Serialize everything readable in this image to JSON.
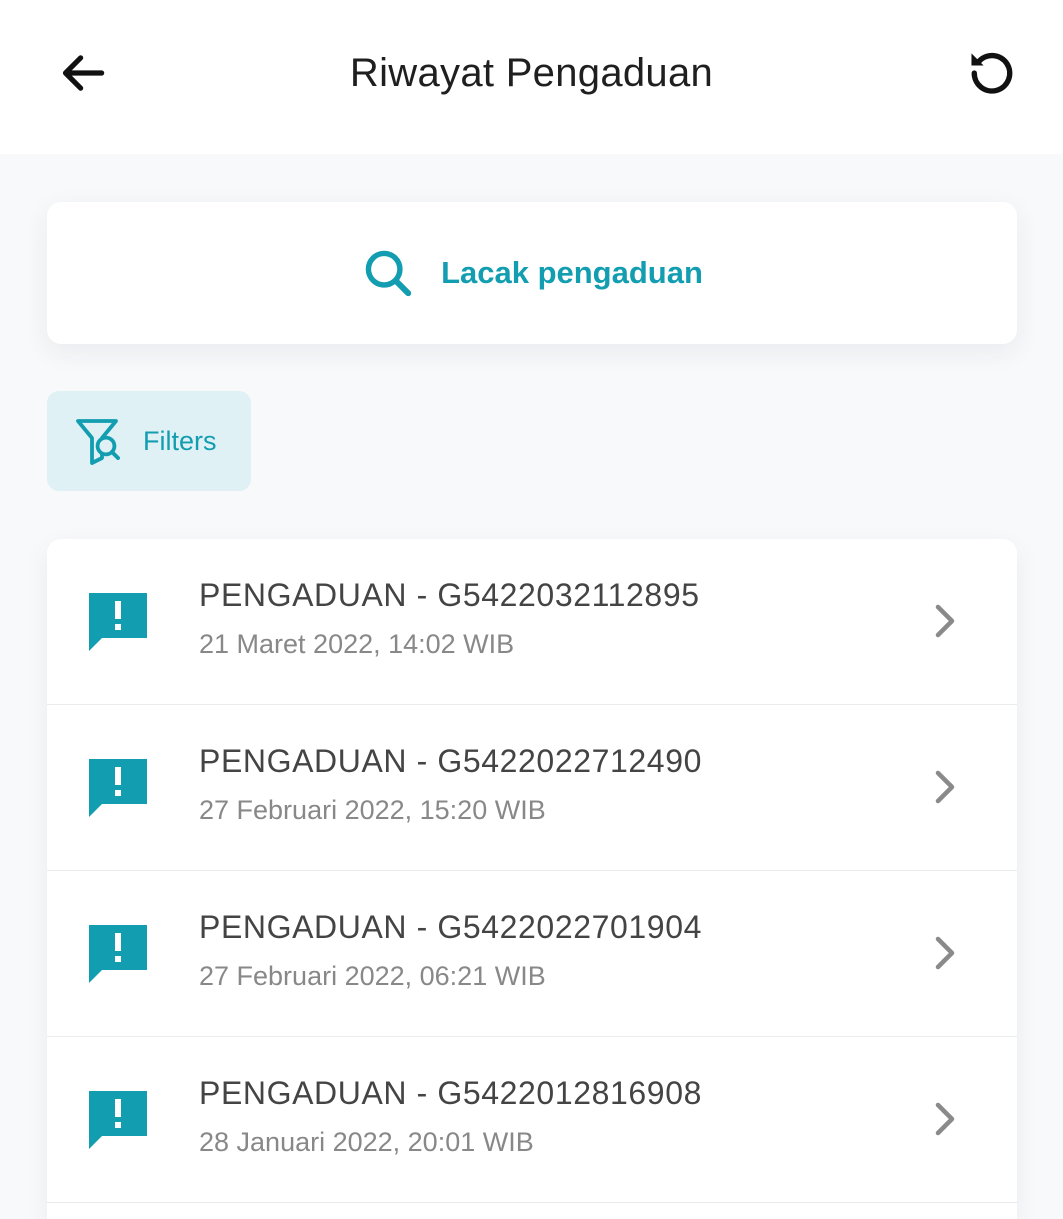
{
  "header": {
    "title": "Riwayat Pengaduan",
    "back_icon": "arrow-left-icon",
    "refresh_icon": "refresh-icon"
  },
  "search": {
    "label": "Lacak pengaduan",
    "icon": "search-icon"
  },
  "filter": {
    "label": "Filters",
    "icon": "filter-search-icon"
  },
  "complaints": [
    {
      "title": "PENGADUAN - G5422032112895",
      "date": "21 Maret 2022, 14:02 WIB",
      "icon": "alert-message-icon"
    },
    {
      "title": "PENGADUAN - G5422022712490",
      "date": "27 Februari 2022, 15:20 WIB",
      "icon": "alert-message-icon"
    },
    {
      "title": "PENGADUAN - G5422022701904",
      "date": "27 Februari 2022, 06:21 WIB",
      "icon": "alert-message-icon"
    },
    {
      "title": "PENGADUAN - G5422012816908",
      "date": "28 Januari 2022, 20:01 WIB",
      "icon": "alert-message-icon"
    }
  ],
  "colors": {
    "accent": "#129db0",
    "accent_bg": "#dff1f5",
    "text_primary": "#1f1f1f",
    "text_item": "#444444",
    "text_secondary": "#888888",
    "chevron": "#8a8a8a",
    "page_bg": "#f8f9fb"
  }
}
